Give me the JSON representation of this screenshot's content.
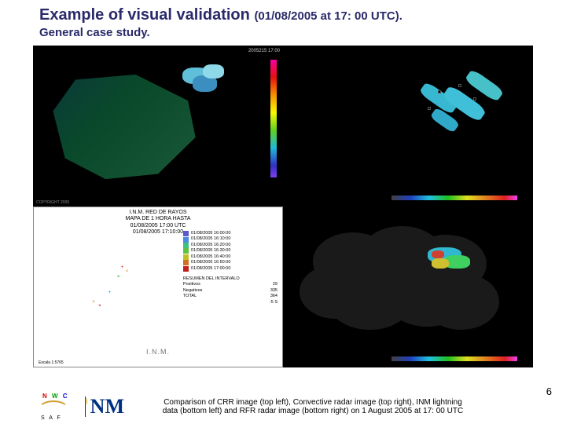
{
  "header": {
    "title_main": "Example of visual validation",
    "title_date": "(01/08/2005 at 17: 00 UTC).",
    "subtitle": "General case study."
  },
  "panels": {
    "top_left": {
      "timestamp_right": "2005215\n17:00",
      "bottom_text": "COPYRIGHT 2005"
    },
    "top_right": {
      "bottom_text": ""
    },
    "bottom_left": {
      "box_line1": "I.N.M. RED DE RAYOS",
      "box_line2": "MAPA DE 1 HORA HASTA",
      "box_line3": "01/08/2005 17:00 UTC",
      "box_line4": "01/08/2005 17:10:00",
      "legend_items": [
        {
          "color": "#5a5ad0",
          "label": "01/08/2005 16:00:00"
        },
        {
          "color": "#4a8ae0",
          "label": "01/08/2005 16:10:00"
        },
        {
          "color": "#40c080",
          "label": "01/08/2005 16:20:00"
        },
        {
          "color": "#60c040",
          "label": "01/08/2005 16:30:00"
        },
        {
          "color": "#c0c020",
          "label": "01/08/2005 16:40:00"
        },
        {
          "color": "#d07020",
          "label": "01/08/2005 16:50:00"
        },
        {
          "color": "#c02020",
          "label": "01/08/2005 17:00:00"
        }
      ],
      "summary_title": "RESUMEN DEL INTERVALO",
      "summary_rows": [
        {
          "k": "Positivos",
          "v": "29"
        },
        {
          "k": "Negativos",
          "v": "335"
        },
        {
          "k": "TOTAL",
          "v": "364"
        }
      ],
      "last_row": "-5 S",
      "agency": "I.N.M.",
      "escala": "Escala 1:5765"
    }
  },
  "footer": {
    "nwc": {
      "n": "N",
      "w": "W",
      "c": "C",
      "saf": "S A F"
    },
    "inm_text": "NM",
    "caption": "Comparison of CRR image (top left), Convective radar image (top right), INM lightning data (bottom left) and RFR radar image (bottom right) on 1 August 2005 at 17: 00 UTC",
    "page": "6"
  }
}
